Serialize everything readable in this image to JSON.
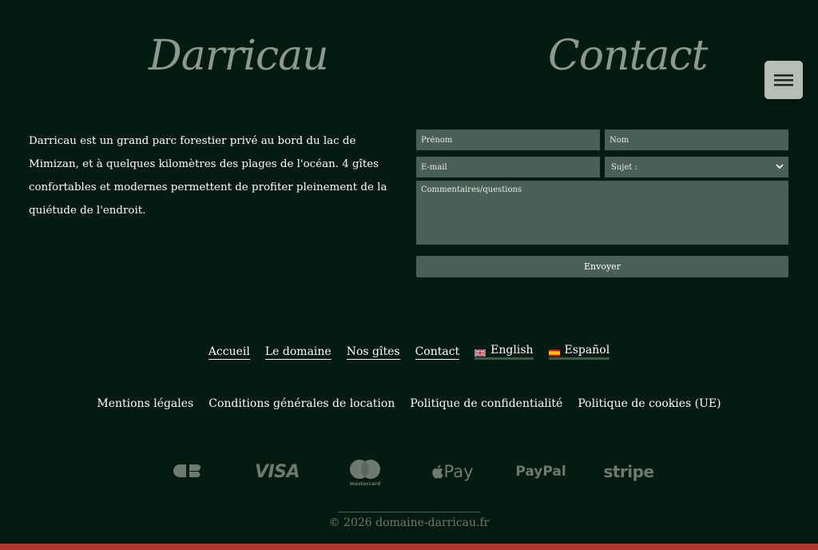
{
  "header": {
    "brand": "Darricau",
    "contact_title": "Contact"
  },
  "intro": {
    "text": "Darricau est un grand parc forestier privé au bord du lac de Mimizan, et à quelques kilomètres des plages de l'océan. 4 gîtes confortables et modernes permettent de profiter pleinement de la quiétude de l'endroit."
  },
  "form": {
    "firstname_placeholder": "Prénom",
    "lastname_placeholder": "Nom",
    "email_placeholder": "E-mail",
    "subject_selected": "Sujet :",
    "comments_placeholder": "Commentaires/questions",
    "send_label": "Envoyer"
  },
  "nav": {
    "items": [
      {
        "label": "Accueil"
      },
      {
        "label": "Le domaine"
      },
      {
        "label": "Nos gîtes"
      },
      {
        "label": "Contact"
      },
      {
        "label": "English"
      },
      {
        "label": "Español"
      }
    ]
  },
  "legal": {
    "items": [
      {
        "label": "Mentions légales"
      },
      {
        "label": "Conditions générales de location"
      },
      {
        "label": "Politique de confidentialité"
      },
      {
        "label": "Politique de cookies (UE)"
      }
    ]
  },
  "payments": {
    "items": [
      {
        "icon": "cb-icon"
      },
      {
        "label": "VISA",
        "icon": "visa-icon"
      },
      {
        "sublabel": "mastercard",
        "icon": "mastercard-icon"
      },
      {
        "label": "Pay",
        "icon": "apple-pay-icon"
      },
      {
        "label": "PayPal",
        "icon": "paypal-icon"
      },
      {
        "label": "stripe",
        "icon": "stripe-icon"
      }
    ]
  },
  "footer": {
    "copyright": "© 2026 domaine-darricau.fr"
  },
  "colors": {
    "background": "#051a10",
    "field": "#4a5f55",
    "accent_bar": "#b0382c",
    "muted": "#6d7a72"
  }
}
